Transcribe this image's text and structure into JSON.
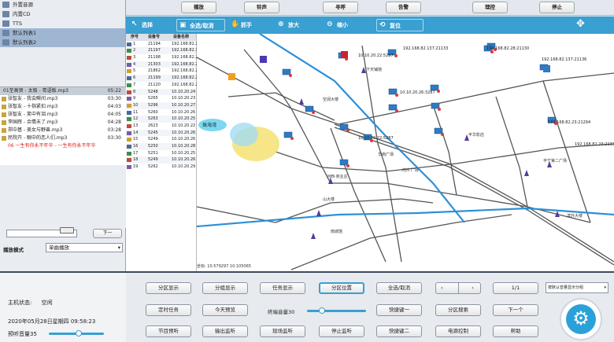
{
  "sources": {
    "items": [
      {
        "label": "外置音源",
        "selected": false
      },
      {
        "label": "内置CD",
        "selected": false
      },
      {
        "label": "TTS",
        "selected": false
      },
      {
        "label": "默认列表1",
        "selected": true
      },
      {
        "label": "默认列表2",
        "selected": true
      }
    ]
  },
  "playlist": {
    "header": {
      "title": "01至高贤 - 太极 - 粤语版.mp3",
      "time": "05:22"
    },
    "items": [
      {
        "title": "张智友 - 我会瞬间.mp3",
        "time": "03:30"
      },
      {
        "title": "张智友 - 十指紧扣.mp3",
        "time": "04:03"
      },
      {
        "title": "张智友 - 笑中有泪.mp3",
        "time": "04:05"
      },
      {
        "title": "李国辉 - 余情未了.mp3",
        "time": "04:28"
      },
      {
        "title": "郑中基 - 美女与野兽.mp3",
        "time": "03:28"
      },
      {
        "title": "民院卉 - 眼中的恋人们.mp3",
        "time": "03:30"
      }
    ],
    "playing": "06 一生有你永不年华 - 一生有你永不年华"
  },
  "controls": {
    "next_label": "下一",
    "mode_label": "播放模式",
    "mode_value": "单曲播放"
  },
  "status": {
    "host_label": "主机状态:",
    "host_value": "空闲",
    "datetime": "2020年05月28日星期四  09:58:23",
    "preview_label": "预听音量35"
  },
  "top_buttons": [
    "播放",
    "铃声",
    "寻呼",
    "告警",
    "理控",
    "停止"
  ],
  "toolbar": {
    "items": [
      {
        "label": "选择",
        "glyph": "↖"
      },
      {
        "label": "全选/取消",
        "glyph": "▣"
      },
      {
        "label": "抓手",
        "glyph": "✋"
      },
      {
        "label": "放大",
        "glyph": "⊕"
      },
      {
        "label": "缩小",
        "glyph": "⊖"
      },
      {
        "label": "复位",
        "glyph": "⟲"
      }
    ]
  },
  "device_table": {
    "headers": [
      "序号",
      "设备号",
      "设备名称"
    ],
    "rows": [
      {
        "no": "1",
        "code": "21194",
        "name": "192.168.82.23"
      },
      {
        "no": "2",
        "code": "21197",
        "name": "192.168.82.30"
      },
      {
        "no": "3",
        "code": "21198",
        "name": "192.168.82.25"
      },
      {
        "no": "4",
        "code": "21303",
        "name": "192.168.82.24"
      },
      {
        "no": "5",
        "code": "21862",
        "name": "192.168.82.28"
      },
      {
        "no": "6",
        "code": "21199",
        "name": "192.168.82.23"
      },
      {
        "no": "7",
        "code": "21120",
        "name": "192.168.82.24"
      },
      {
        "no": "8",
        "code": "5248",
        "name": "10.10.20.24"
      },
      {
        "no": "9",
        "code": "5265",
        "name": "10.10.20.23"
      },
      {
        "no": "10",
        "code": "5296",
        "name": "10.10.20.27"
      },
      {
        "no": "11",
        "code": "5260",
        "name": "10.10.20.26"
      },
      {
        "no": "12",
        "code": "5263",
        "name": "10.10.20.25"
      },
      {
        "no": "13",
        "code": "2623",
        "name": "10.10.20.22"
      },
      {
        "no": "14",
        "code": "5245",
        "name": "10.10.20.26"
      },
      {
        "no": "15",
        "code": "5249",
        "name": "10.10.20.26"
      },
      {
        "no": "16",
        "code": "5250",
        "name": "10.10.20.28"
      },
      {
        "no": "17",
        "code": "5251",
        "name": "10.10.20.25"
      },
      {
        "no": "18",
        "code": "5249",
        "name": "10.10.20.26"
      },
      {
        "no": "19",
        "code": "5262",
        "name": "10.10.20.29"
      }
    ]
  },
  "map": {
    "labels": [
      "10.10.20.22:5287",
      "192.168.82.137:21133",
      "10.10.20.22:5287",
      "192.168.82.28:21130",
      "192.168.82.23:21294",
      "10.10.20.26:3287",
      "192.168.82.137:21136",
      "192.168.82.23:21335"
    ],
    "places": [
      "下天铺馆",
      "空阔大楼",
      "河西·商业庄",
      "丰宁第二广场",
      "河外·广场",
      "丰华影店",
      "山大楼",
      "滨外大楼",
      "南城馆",
      "华南广场"
    ],
    "coords": "坐标: 10.579297 10.105065",
    "zone_label": "珠海湾"
  },
  "bottom": {
    "row1": [
      "分区显示",
      "分组显示",
      "任务显示",
      "分区位置",
      "全选/取消",
      "1/1"
    ],
    "row2": [
      "定时任务",
      "今天预览",
      "快捷键一",
      "分区搜索",
      "下一个"
    ],
    "row3": [
      "节目预听",
      "输出监听",
      "现场监听",
      "停止监听",
      "快捷键二",
      "电源控制",
      "帮助"
    ],
    "volume_label": "终端音量30",
    "combo": "按默认音量显示分组"
  }
}
